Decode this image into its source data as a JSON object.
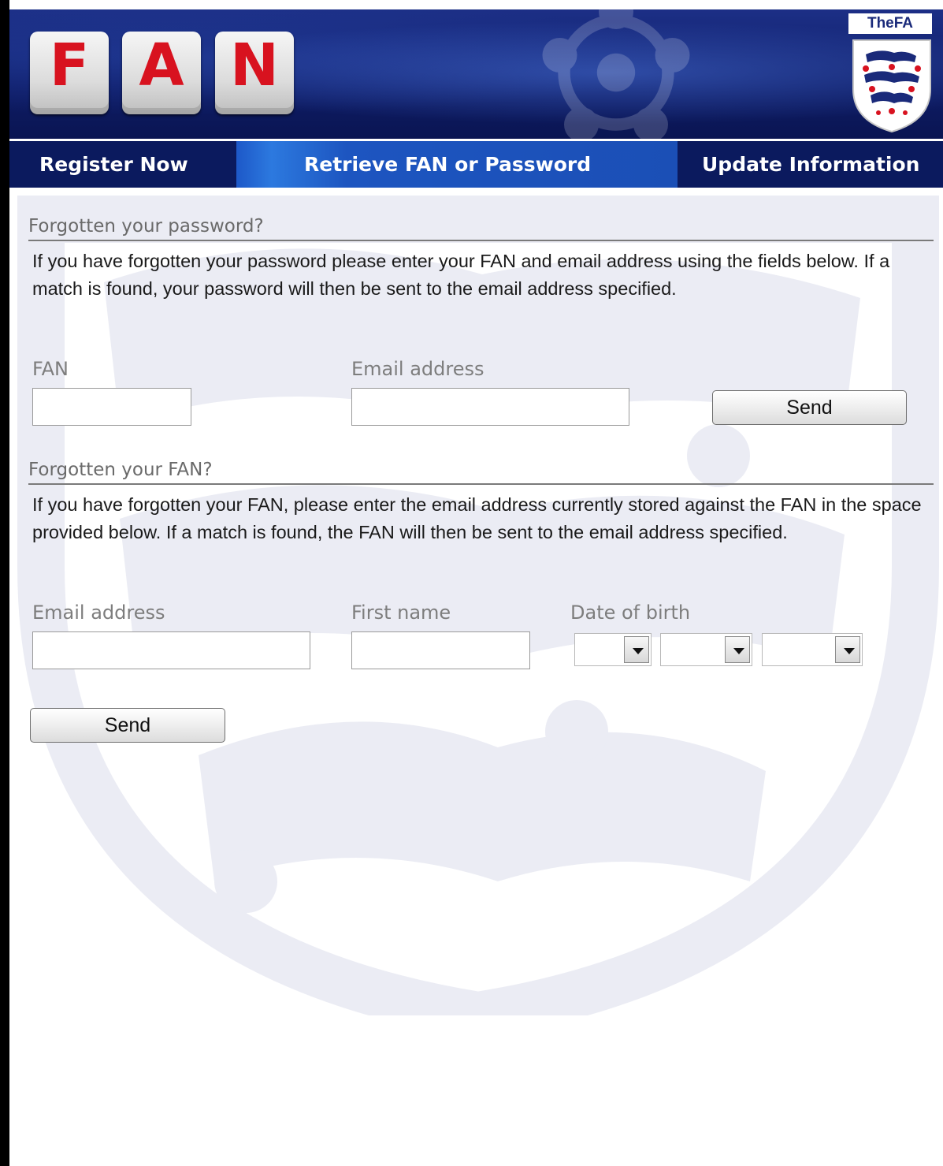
{
  "header": {
    "logo_letters": [
      "F",
      "A",
      "N"
    ],
    "crest_label": "TheFA"
  },
  "nav": {
    "items": [
      {
        "label": "Register Now",
        "active": false
      },
      {
        "label": "Retrieve FAN or Password",
        "active": true
      },
      {
        "label": "Update Information",
        "active": false
      }
    ]
  },
  "password_section": {
    "title": "Forgotten your password?",
    "description": "If you have forgotten your password please enter your FAN and email address using the fields below. If a match is found, your password will then be sent to the email address specified.",
    "fan_label": "FAN",
    "fan_value": "",
    "email_label": "Email address",
    "email_value": "",
    "send_label": "Send"
  },
  "fan_section": {
    "title": "Forgotten your FAN?",
    "description": "If you have forgotten your FAN, please enter the email address currently stored against the FAN in the space provided below. If a match is found, the FAN will then be sent to the email address specified.",
    "email_label": "Email address",
    "email_value": "",
    "first_name_label": "First name",
    "first_name_value": "",
    "dob_label": "Date of birth",
    "dob_day": "",
    "dob_month": "",
    "dob_year": "",
    "send_label": "Send"
  },
  "colors": {
    "header_bg": "#0e1c66",
    "nav_active": "#1d58c8",
    "logo_letter": "#d8121f",
    "section_title": "#6a6a6a"
  },
  "icons": [
    "dropdown-arrow-icon",
    "three-lions-crest-icon"
  ]
}
